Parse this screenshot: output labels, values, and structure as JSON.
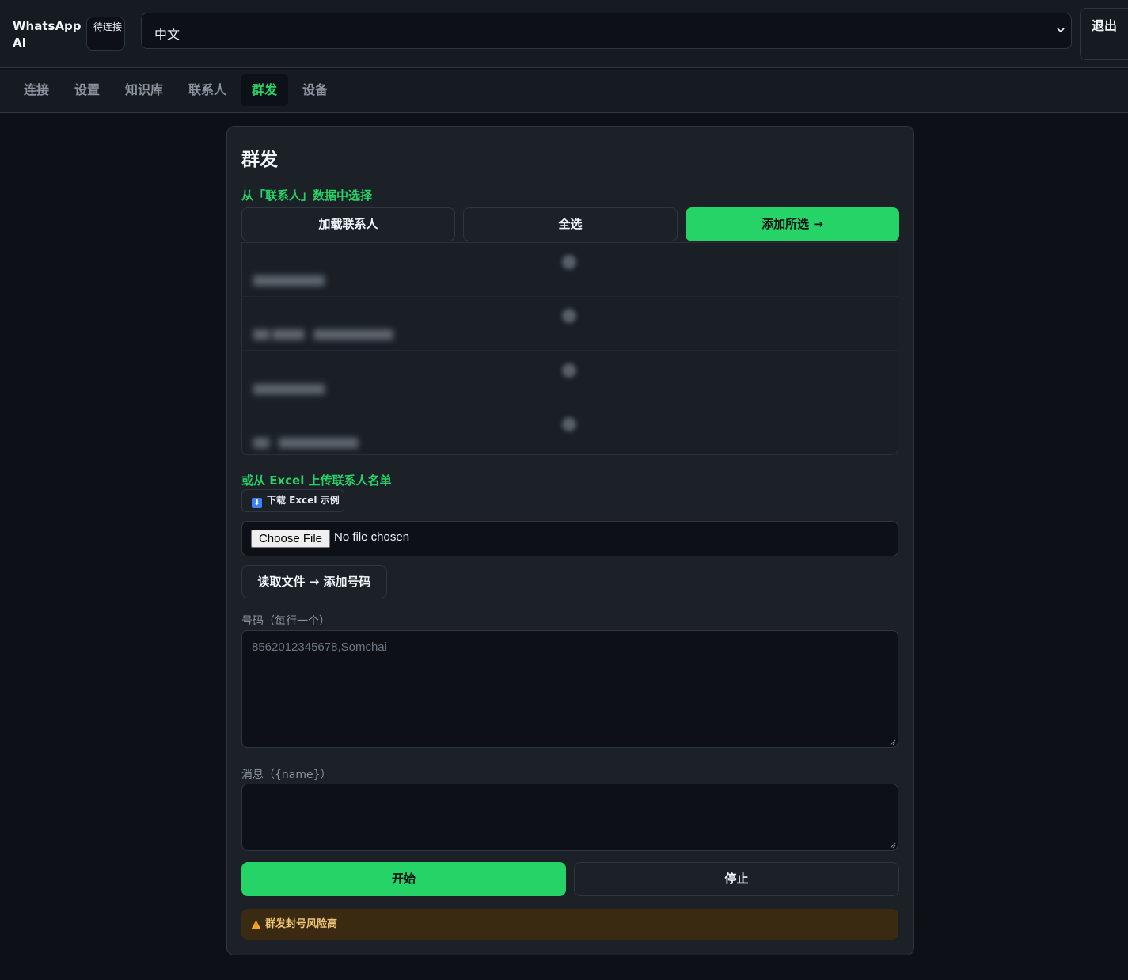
{
  "header": {
    "brand": "WhatsApp AI",
    "status": "待连接",
    "language": "中文",
    "logout_label": "退出"
  },
  "nav": {
    "tabs": [
      {
        "label": "连接",
        "active": false
      },
      {
        "label": "设置",
        "active": false
      },
      {
        "label": "知识库",
        "active": false
      },
      {
        "label": "联系人",
        "active": false
      },
      {
        "label": "群发",
        "active": true
      },
      {
        "label": "设备",
        "active": false
      }
    ]
  },
  "broadcast": {
    "title": "群发",
    "contacts_section": {
      "label": "从「联系人」数据中选择",
      "load_button": "加载联系人",
      "select_all_button": "全选",
      "add_selected_button": "添加所选 →"
    },
    "excel_section": {
      "label": "或从 Excel 上传联系人名单",
      "download_sample": "下载 Excel 示例",
      "file_button": "Choose File",
      "file_status": "No file chosen",
      "read_file_button": "读取文件 → 添加号码"
    },
    "numbers": {
      "label": "号码（每行一个）",
      "value": "",
      "placeholder": "8562012345678,Somchai"
    },
    "message": {
      "label": "消息（{name}）",
      "value": ""
    },
    "start_button": "开始",
    "stop_button": "停止",
    "warning": "群发封号风险高"
  },
  "colors": {
    "accent": "#25d366",
    "background": "#0d1117",
    "card": "#1c2128",
    "warning_bg": "#3b2a12",
    "warning_text": "#f0c674"
  }
}
